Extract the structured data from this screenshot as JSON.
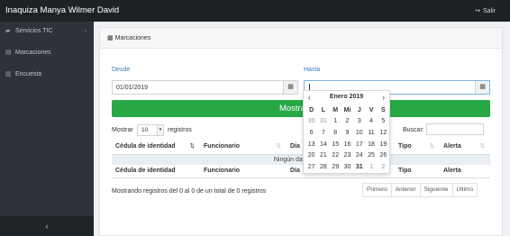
{
  "app": {
    "title": "Inaquiza Manya Wilmer David",
    "logout_label": "Salir"
  },
  "sidebar": {
    "items": [
      {
        "label": "Servicios TIC",
        "icon": "folder-icon",
        "has_submenu": true
      },
      {
        "label": "Marcaciones",
        "icon": "file-icon",
        "has_submenu": false
      },
      {
        "label": "Encuesta",
        "icon": "chart-icon",
        "has_submenu": false
      }
    ],
    "collapse_label": "‹"
  },
  "card": {
    "title": "Marcaciones",
    "desde_label": "Desde",
    "desde_value": "01/01/2019",
    "hasta_label": "Hasta",
    "hasta_value": "",
    "show_button": "Mostrar ma"
  },
  "table_controls": {
    "show_label": "Mostrar",
    "length_value": "10",
    "registros_label": "registros",
    "search_label": "Buscar:",
    "search_value": ""
  },
  "table": {
    "columns": [
      "Cédula de identidad",
      "Funcionario",
      "Día",
      "",
      "",
      "Tipo",
      "Alerta"
    ],
    "empty_message": "Ningún dato dispon",
    "info": "Mostrando registros del 0 al 0 de un total de 0 registros"
  },
  "pagination": {
    "first": "Primero",
    "previous": "Anterior",
    "next": "Siguiente",
    "last": "Último"
  },
  "datepicker": {
    "title": "Enero 2019",
    "prev": "‹",
    "next": "›",
    "weekdays": [
      "D",
      "L",
      "M",
      "Mi",
      "J",
      "V",
      "S"
    ],
    "weeks": [
      [
        "30",
        "31",
        "1",
        "2",
        "3",
        "4",
        "5"
      ],
      [
        "6",
        "7",
        "8",
        "9",
        "10",
        "11",
        "12"
      ],
      [
        "13",
        "14",
        "15",
        "16",
        "17",
        "18",
        "19"
      ],
      [
        "20",
        "21",
        "22",
        "23",
        "24",
        "25",
        "26"
      ],
      [
        "27",
        "28",
        "29",
        "30",
        "31",
        "1",
        "2"
      ]
    ],
    "today": "31"
  }
}
